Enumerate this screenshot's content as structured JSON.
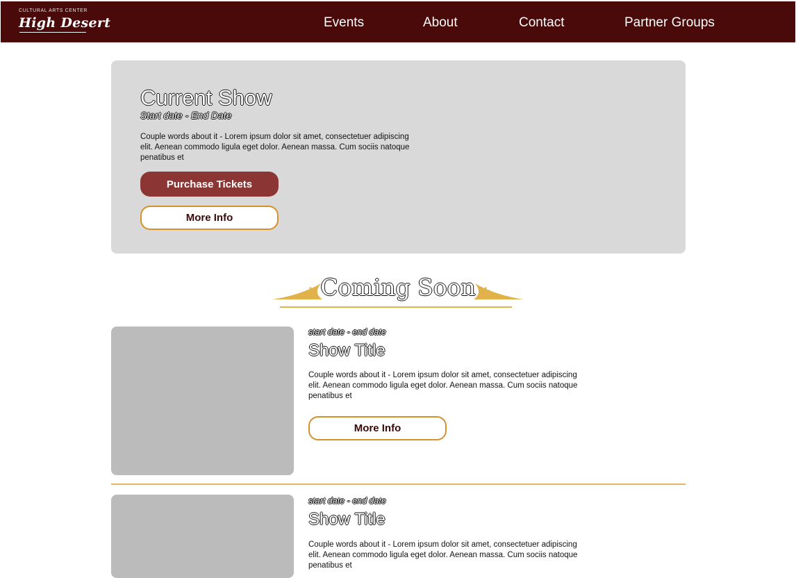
{
  "header": {
    "logo_small": "CULTURAL ARTS CENTER",
    "logo_main": "High Desert",
    "nav": [
      "Events",
      "About",
      "Contact",
      "Partner Groups"
    ]
  },
  "hero": {
    "title": "Current Show",
    "dates": "Start date - End Date",
    "description": "Couple words about it  -  Lorem ipsum dolor sit amet, consectetuer adipiscing elit. Aenean commodo ligula eget dolor. Aenean massa. Cum sociis natoque penatibus et",
    "purchase_label": "Purchase Tickets",
    "more_label": "More Info"
  },
  "coming_soon": {
    "heading": "Coming Soon"
  },
  "shows": [
    {
      "dates": "start date - end date",
      "title": "Show Title",
      "description": "Couple words about it  -  Lorem ipsum dolor sit amet, consectetuer adipiscing elit. Aenean commodo ligula eget dolor. Aenean massa. Cum sociis natoque penatibus et",
      "more_label": "More Info"
    },
    {
      "dates": "start date - end date",
      "title": "Show Title",
      "description": "Couple words about it  -  Lorem ipsum dolor sit amet, consectetuer adipiscing elit. Aenean commodo ligula eget dolor. Aenean massa. Cum sociis natoque penatibus et"
    }
  ],
  "colors": {
    "header_bg": "#4a0a09",
    "primary_button": "#8c3535",
    "accent_gold": "#d3912e",
    "panel_bg": "#d9d9d9",
    "image_placeholder": "#bbbbbb"
  }
}
